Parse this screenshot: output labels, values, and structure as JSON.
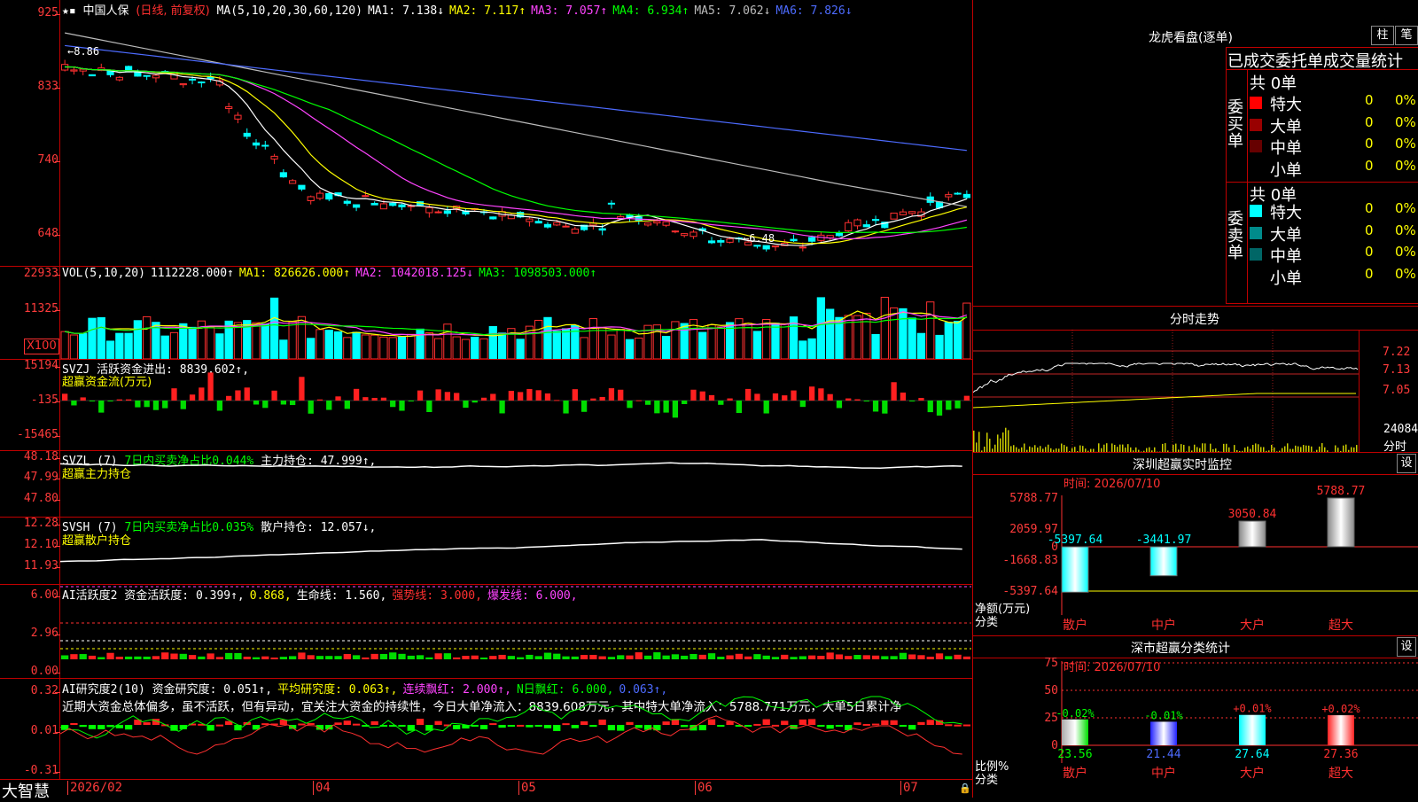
{
  "stock": {
    "name": "中国人保",
    "mode": "(日线, 前复权)",
    "ma_line": [
      {
        "label": "MA(5,10,20,30,60,120)",
        "color": "#ffffff"
      },
      {
        "label": "MA1: 7.138↓",
        "color": "#ffffff"
      },
      {
        "label": "MA2: 7.117↑",
        "color": "#ffff00"
      },
      {
        "label": "MA3: 7.057↑",
        "color": "#ff44ff"
      },
      {
        "label": "MA4: 6.934↑",
        "color": "#00ff00"
      },
      {
        "label": "MA5: 7.062↓",
        "color": "#bbbbbb"
      },
      {
        "label": "MA6: 7.826↓",
        "color": "#4d6bff"
      }
    ],
    "price_axis": [
      "925",
      "833",
      "740",
      "648"
    ],
    "high_marker": "8.86",
    "low_marker": "6.48"
  },
  "vol_panel": {
    "header": [
      {
        "label": "VOL(5,10,20)",
        "color": "#ffffff"
      },
      {
        "label": "1112228.000↑",
        "color": "#ffffff"
      },
      {
        "label": "MA1: 826626.000↑",
        "color": "#ffff00"
      },
      {
        "label": "MA2: 1042018.125↓",
        "color": "#ff44ff"
      },
      {
        "label": "MA3: 1098503.000↑",
        "color": "#00ff00"
      }
    ],
    "axis": [
      "22933",
      "11325"
    ],
    "unit": "X100"
  },
  "svzj_panel": {
    "header": "SVZJ  活跃资金进出: 8839.602↑,",
    "sub": "超赢资金流(万元)",
    "axis": [
      "15194",
      "-135",
      "-15465"
    ]
  },
  "svzl_panel": {
    "header_a": "SVZL (7)",
    "header_b": "7日内买卖净占比0.044%",
    "header_c": "主力持仓: 47.999↑,",
    "sub": "超赢主力持仓",
    "axis": [
      "48.18",
      "47.99",
      "47.80"
    ]
  },
  "svsh_panel": {
    "header_a": "SVSH (7)",
    "header_b": "7日内买卖净占比0.035%",
    "header_c": "散户持仓: 12.057↓,",
    "sub": "超赢散户持仓",
    "axis": [
      "12.28",
      "12.10",
      "11.93"
    ]
  },
  "ai_active_panel": {
    "header": [
      {
        "label": "AI活跃度2 资金活跃度: 0.399↑,",
        "color": "#ffffff"
      },
      {
        "label": "0.868,",
        "color": "#ffff00"
      },
      {
        "label": "生命线: 1.560,",
        "color": "#ffffff"
      },
      {
        "label": "强势线: 3.000,",
        "color": "#ff3030"
      },
      {
        "label": "爆发线: 6.000,",
        "color": "#ff44ff"
      }
    ],
    "axis": [
      "6.00",
      "2.96",
      "0.00"
    ]
  },
  "ai_research_panel": {
    "header": [
      {
        "label": "AI研究度2(10) 资金研究度: 0.051↑,",
        "color": "#ffffff"
      },
      {
        "label": "平均研究度: 0.063↑,",
        "color": "#ffff00"
      },
      {
        "label": "连续飘红: 2.000↑,",
        "color": "#ff44ff"
      },
      {
        "label": "N日飘红: 6.000,",
        "color": "#00ff00"
      },
      {
        "label": "0.063↑,",
        "color": "#4d6bff"
      }
    ],
    "commentary": "近期大资金总体偏多，虽不活跃，但有异动，宜关注大资金的持续性，今日大单净流入：8839.608万元，其中特大单净流入：5788.771万元，大单5日累计净",
    "axis": [
      "0.32",
      "0.01",
      "-0.31"
    ]
  },
  "bottom_axis": {
    "brand": "大智慧",
    "dates": [
      "2026/02",
      "04",
      "05",
      "06",
      "07"
    ]
  },
  "right_panel": {
    "lhb_title": "龙虎看盘(逐单)",
    "btn_zhu": "柱",
    "btn_bi": "笔",
    "stats_title": "已成交委托单成交量统计",
    "buy_label": "委买单",
    "sell_label": "委卖单",
    "buy_total": "共 0单",
    "sell_total": "共 0单",
    "buy_rows": [
      {
        "label": "特大",
        "count": "0",
        "pct": "0%",
        "color": "#ff0000"
      },
      {
        "label": "大单",
        "count": "0",
        "pct": "0%",
        "color": "#990000"
      },
      {
        "label": "中单",
        "count": "0",
        "pct": "0%",
        "color": "#660000"
      },
      {
        "label": "小单",
        "count": "0",
        "pct": "0%",
        "color": ""
      }
    ],
    "sell_rows": [
      {
        "label": "特大",
        "count": "0",
        "pct": "0%",
        "color": "#00ffff"
      },
      {
        "label": "大单",
        "count": "0",
        "pct": "0%",
        "color": "#008b8b"
      },
      {
        "label": "中单",
        "count": "0",
        "pct": "0%",
        "color": "#006666"
      },
      {
        "label": "小单",
        "count": "0",
        "pct": "0%",
        "color": ""
      }
    ],
    "intraday_title": "分时走势",
    "intraday_axis": [
      "7.22",
      "7.13",
      "7.05"
    ],
    "intraday_vol": "24084",
    "intraday_vol_unit": "分时",
    "monitor_title": "深圳超赢实时监控",
    "set_label": "设",
    "monitor_time": "时间: 2026/07/10",
    "monitor_axis": [
      "5788.77",
      "2059.97",
      "0",
      "-1668.83",
      "-5397.64"
    ],
    "monitor_ylabel1": "净额(万元)",
    "monitor_ylabel2": "分类",
    "monitor_categories": [
      "散户",
      "中户",
      "大户",
      "超大"
    ],
    "monitor_values": [
      "-5397.64",
      "-3441.97",
      "3050.84",
      "5788.77"
    ],
    "classify_title": "深市超赢分类统计",
    "classify_time": "时间: 2026/07/10",
    "classify_axis": [
      "75",
      "50",
      "25",
      "0"
    ],
    "classify_ylabel1": "比例%",
    "classify_ylabel2": "分类",
    "classify_changes": [
      "-0.02%",
      "-0.01%",
      "+0.01%",
      "+0.02%"
    ],
    "classify_values": [
      "23.56",
      "21.44",
      "27.64",
      "27.36"
    ],
    "classify_categories": [
      "散户",
      "中户",
      "大户",
      "超大"
    ]
  }
}
